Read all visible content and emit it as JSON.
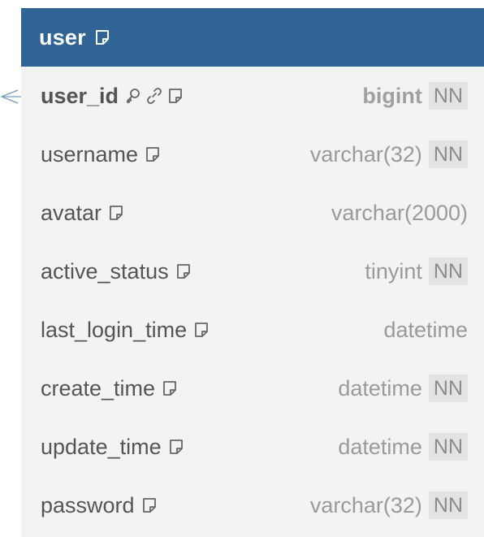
{
  "table": {
    "name": "user",
    "columns": [
      {
        "name": "user_id",
        "type": "bigint",
        "nn": "NN",
        "pk": true,
        "fk": true
      },
      {
        "name": "username",
        "type": "varchar(32)",
        "nn": "NN"
      },
      {
        "name": "avatar",
        "type": "varchar(2000)",
        "nn": ""
      },
      {
        "name": "active_status",
        "type": "tinyint",
        "nn": "NN"
      },
      {
        "name": "last_login_time",
        "type": "datetime",
        "nn": ""
      },
      {
        "name": "create_time",
        "type": "datetime",
        "nn": "NN"
      },
      {
        "name": "update_time",
        "type": "datetime",
        "nn": "NN"
      },
      {
        "name": "password",
        "type": "varchar(32)",
        "nn": "NN"
      }
    ]
  },
  "colors": {
    "header": "#2f6495",
    "body": "#f3f3f3",
    "nn_badge": "#e3e3e3"
  },
  "icons": {
    "note": "note-icon",
    "key": "key-icon",
    "link": "link-icon"
  }
}
